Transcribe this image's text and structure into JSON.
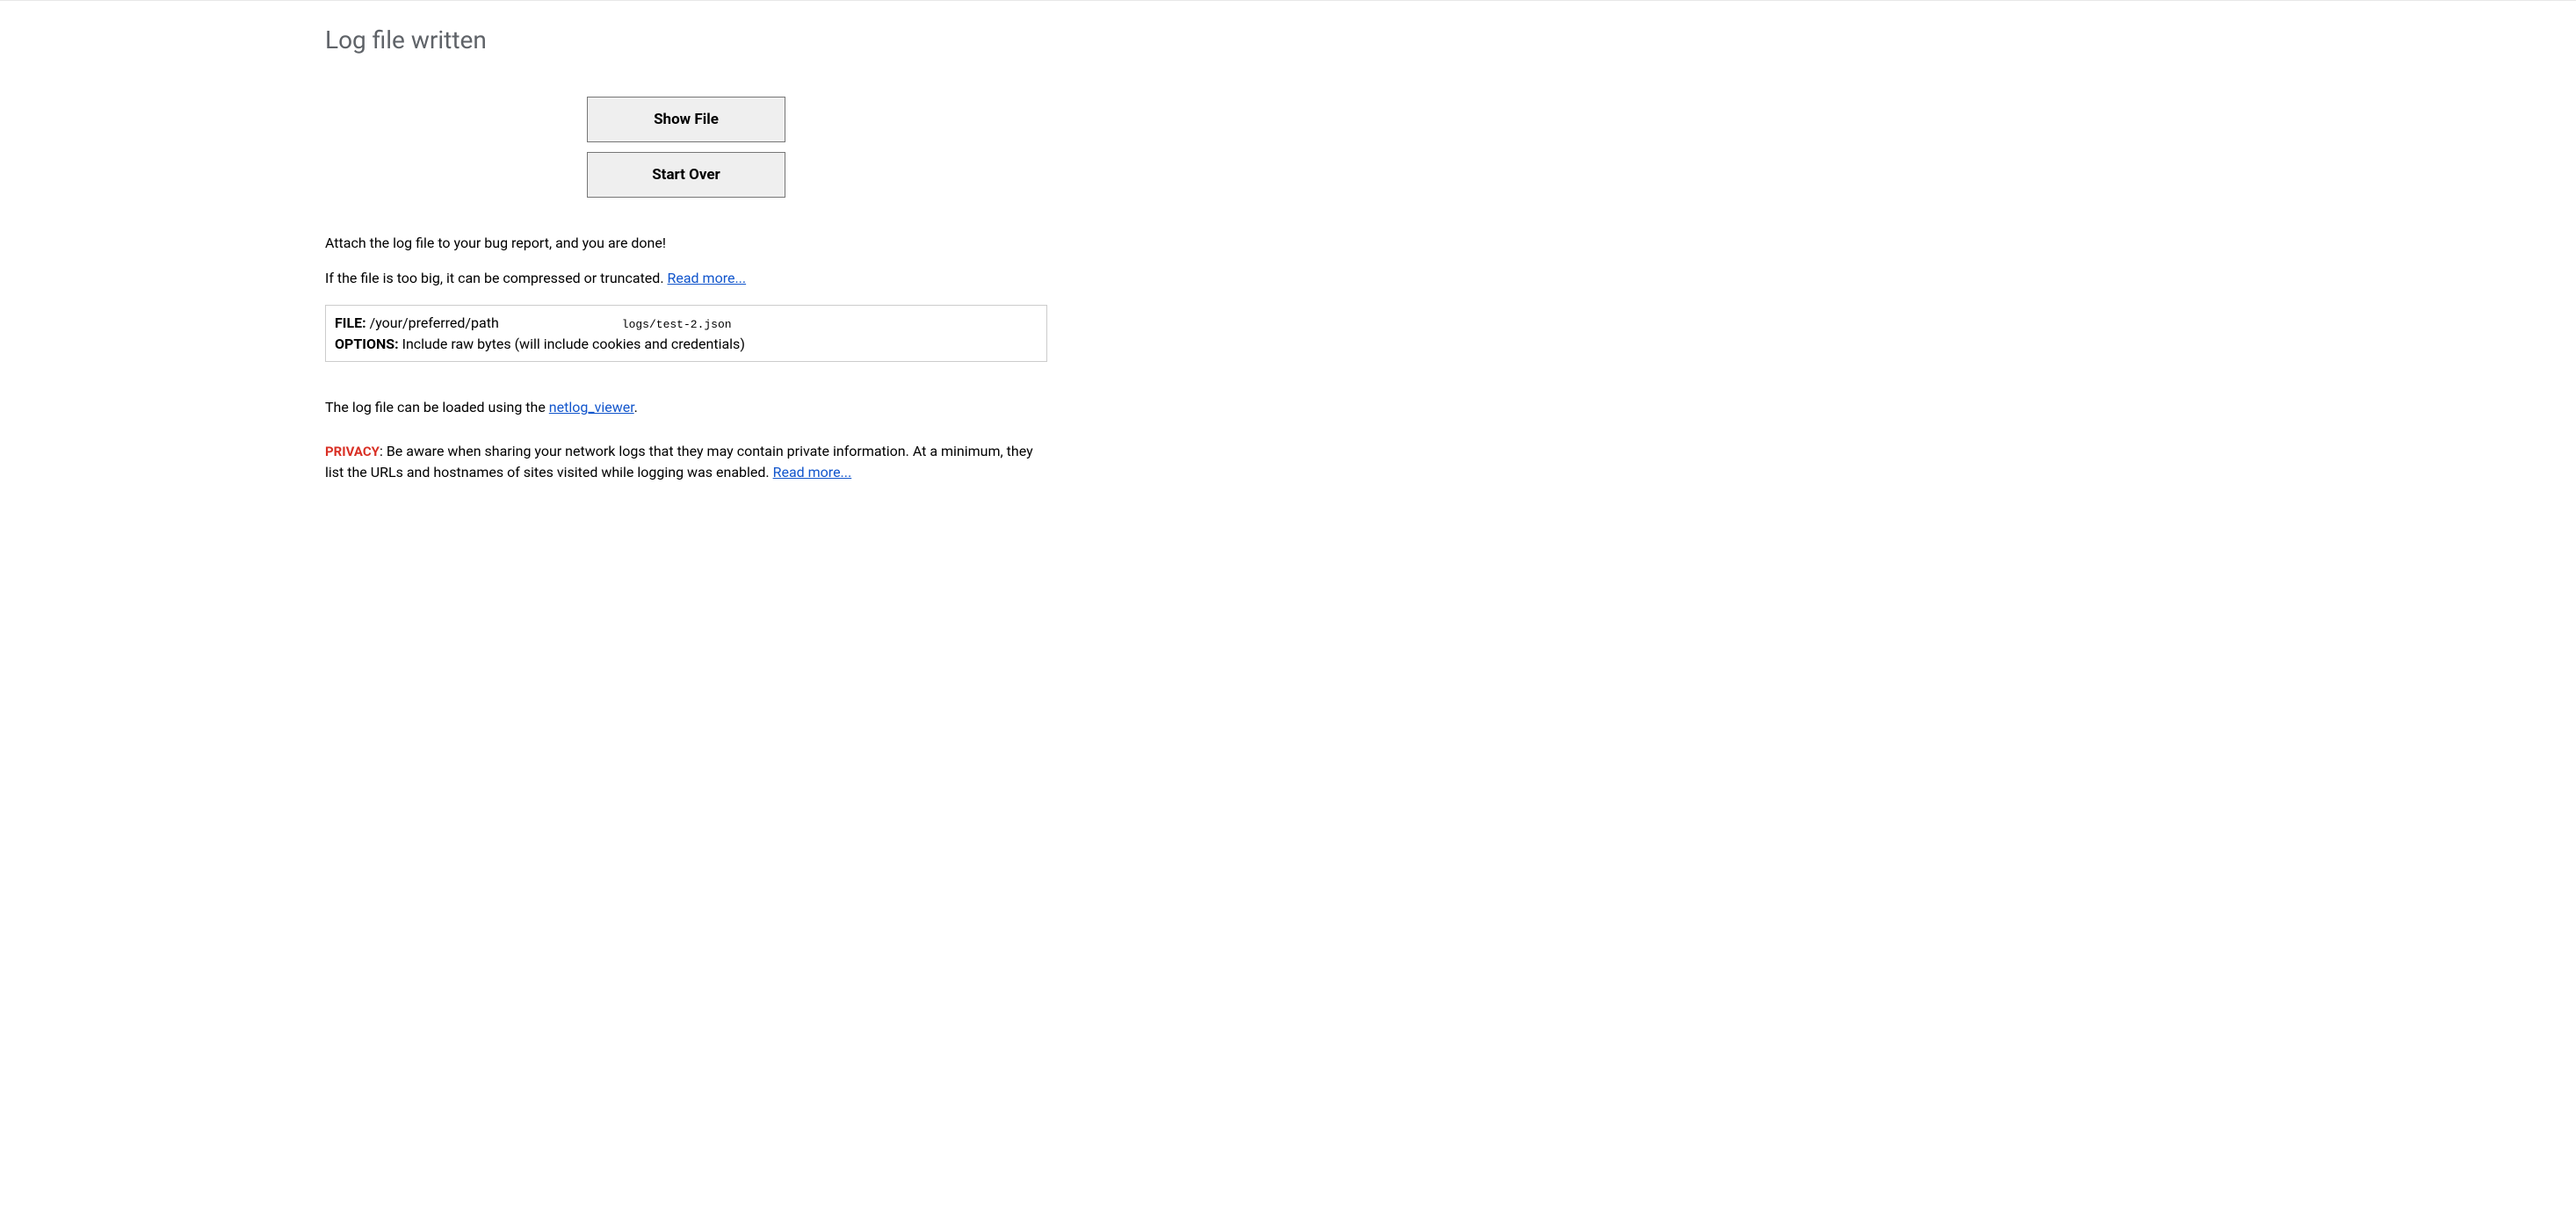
{
  "header": {
    "title": "Log file written"
  },
  "buttons": {
    "show_file": "Show File",
    "start_over": "Start Over"
  },
  "instructions": {
    "attach": "Attach the log file to your bug report, and you are done!",
    "too_big_prefix": "If the file is too big, it can be compressed or truncated. ",
    "read_more": "Read more..."
  },
  "info_box": {
    "file_label": "FILE:",
    "file_path_prefix": " /your/preferred/path",
    "file_path_suffix": "logs/test-2.json",
    "options_label": "OPTIONS:",
    "options_value": " Include raw bytes (will include cookies and credentials)"
  },
  "viewer": {
    "prefix": "The log file can be loaded using the ",
    "link": "netlog_viewer",
    "suffix": "."
  },
  "privacy": {
    "label": "PRIVACY",
    "text": ": Be aware when sharing your network logs that they may contain private information. At a minimum, they list the URLs and hostnames of sites visited while logging was enabled. ",
    "read_more": "Read more..."
  }
}
